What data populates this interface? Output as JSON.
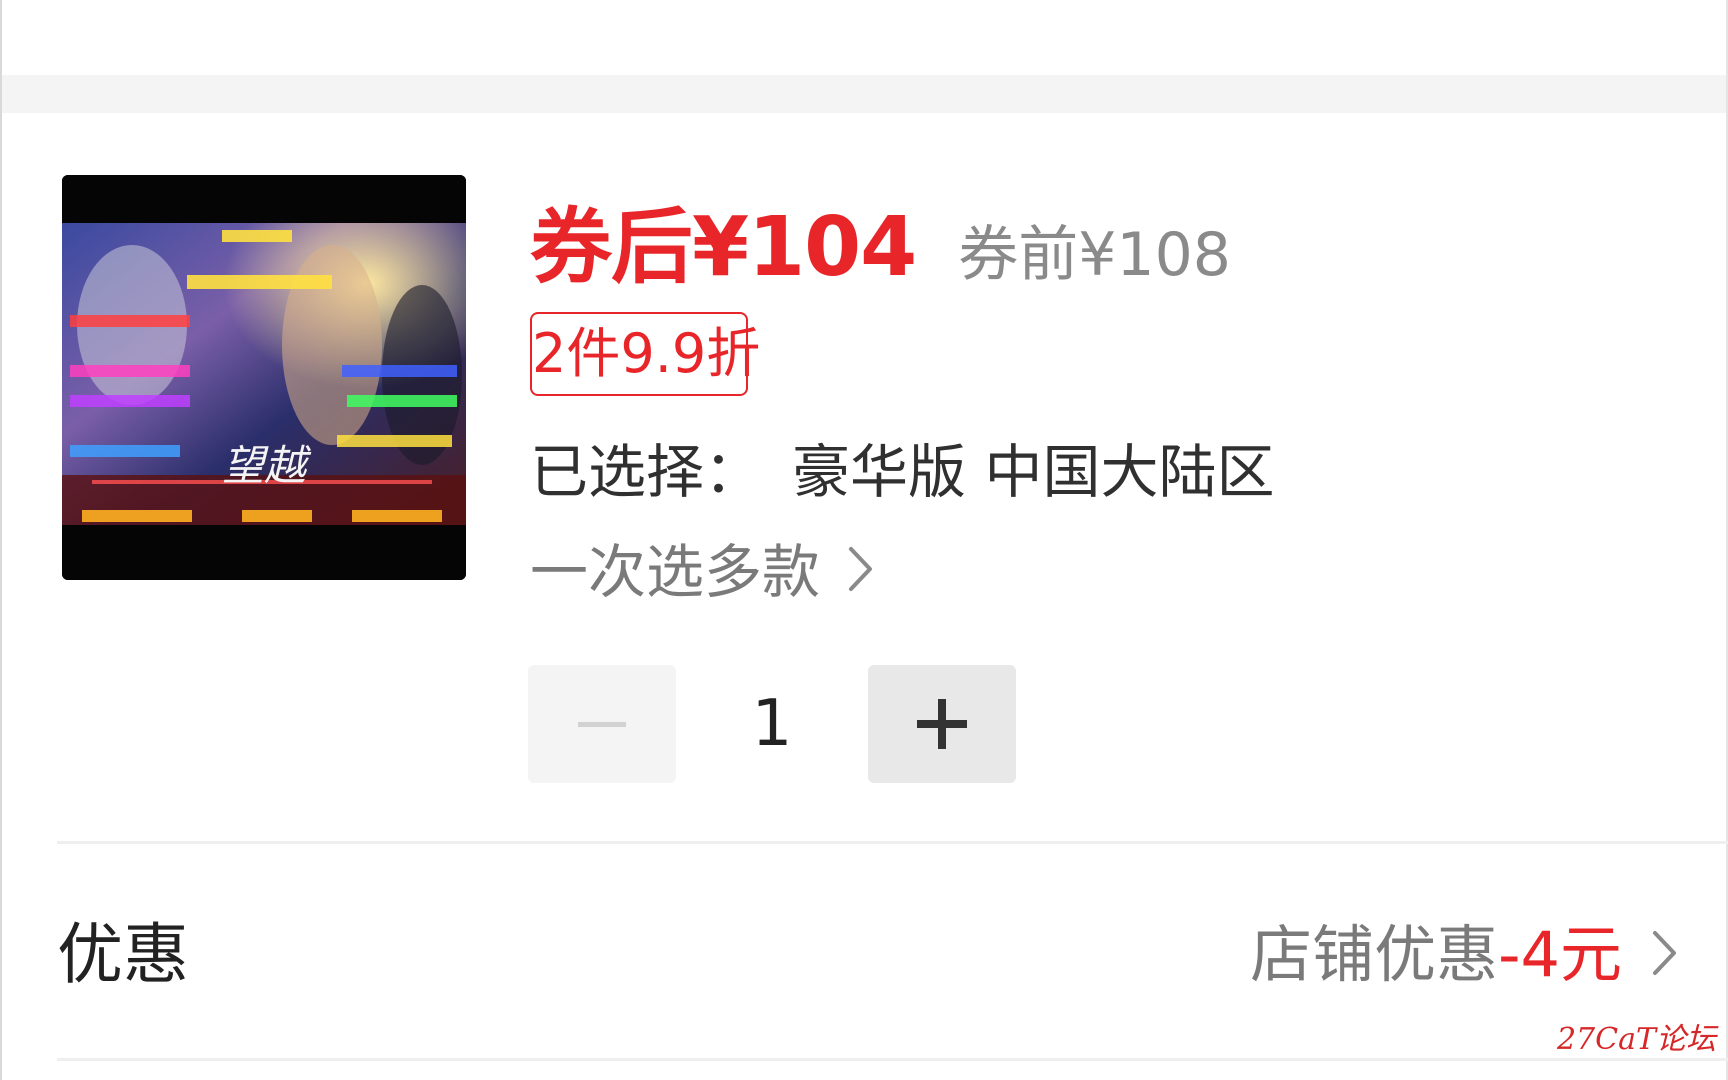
{
  "product": {
    "coupon_price": "券后¥104",
    "original_price": "券前¥108",
    "promo_tag": "2件9.9折",
    "selected_label": "已选择：",
    "selected_value": "豪华版 中国大陆区",
    "multi_select": "一次选多款",
    "image_title": "望越"
  },
  "quantity": {
    "value": "1"
  },
  "discount": {
    "label": "优惠",
    "shop_label": "店铺优惠",
    "shop_value": "-4元"
  },
  "watermark": "27CaT论坛",
  "colors": {
    "accent": "#e8262a",
    "muted": "#7a7a7a",
    "text": "#222222"
  }
}
